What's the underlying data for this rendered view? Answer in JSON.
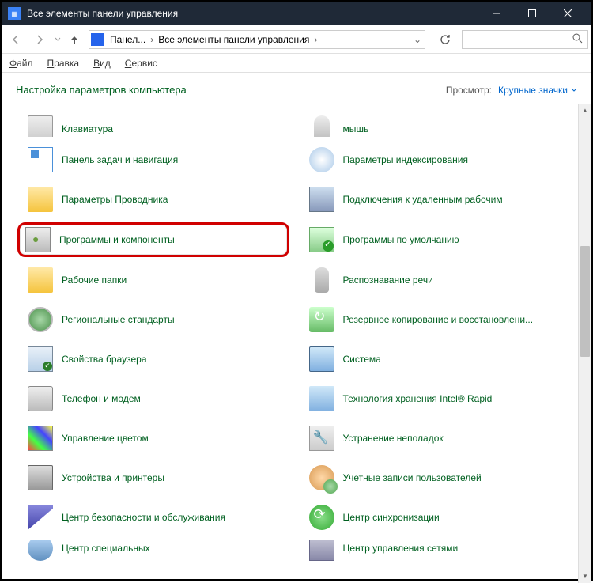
{
  "titlebar": {
    "title": "Все элементы панели управления"
  },
  "breadcrumb": {
    "seg1": "Панел...",
    "seg2": "Все элементы панели управления"
  },
  "menu": {
    "file": "Файл",
    "edit": "Правка",
    "view": "Вид",
    "tools": "Сервис"
  },
  "header": {
    "title": "Настройка параметров компьютера",
    "view_label": "Просмотр:",
    "view_value": "Крупные значки"
  },
  "items": {
    "keyboard": "Клавиатура",
    "mouse": "мышь",
    "taskbar": "Панель задач и навигация",
    "indexing": "Параметры индексирования",
    "explorer": "Параметры Проводника",
    "remote": "Подключения к удаленным рабочим",
    "programs": "Программы и компоненты",
    "defaults": "Программы по умолчанию",
    "workfolders": "Рабочие папки",
    "speech": "Распознавание речи",
    "region": "Региональные стандарты",
    "backup": "Резервное копирование и восстановлени...",
    "browser": "Свойства браузера",
    "system": "Система",
    "phone": "Телефон и модем",
    "intel": "Технология хранения Intel® Rapid",
    "color": "Управление цветом",
    "troubleshoot": "Устранение неполадок",
    "printers": "Устройства и принтеры",
    "users": "Учетные записи пользователей",
    "security": "Центр безопасности и обслуживания",
    "sync": "Центр синхронизации",
    "access": "Центр специальных",
    "network": "Центр управления сетями"
  }
}
